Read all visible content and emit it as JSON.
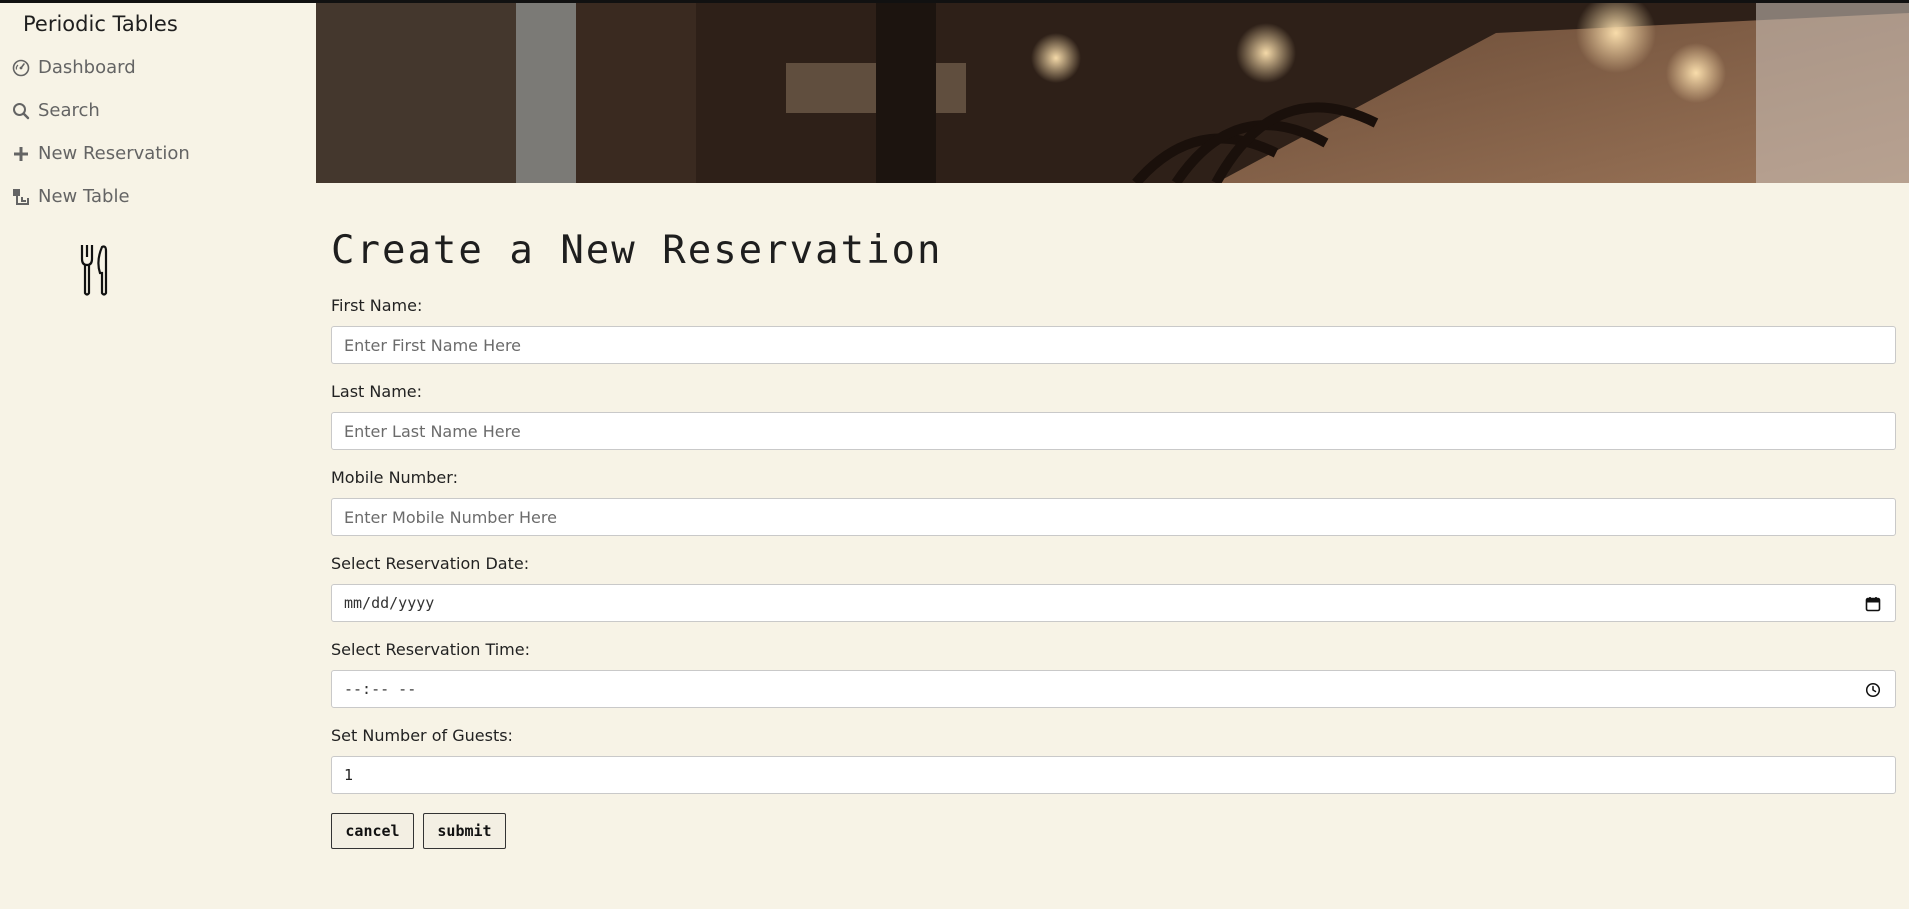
{
  "app": {
    "brand": "Periodic Tables"
  },
  "sidebar": {
    "items": [
      {
        "label": "Dashboard",
        "icon": "dashboard-icon"
      },
      {
        "label": "Search",
        "icon": "search-icon"
      },
      {
        "label": "New Reservation",
        "icon": "plus-icon"
      },
      {
        "label": "New Table",
        "icon": "new-table-icon"
      }
    ],
    "logo_icon": "fork-knife-icon"
  },
  "hero": {
    "image": "restaurant-interior-photo"
  },
  "form": {
    "title": "Create a New Reservation",
    "fields": [
      {
        "label": "First Name:",
        "placeholder": "Enter First Name Here",
        "value": ""
      },
      {
        "label": "Last Name:",
        "placeholder": "Enter Last Name Here",
        "value": ""
      },
      {
        "label": "Mobile Number:",
        "placeholder": "Enter Mobile Number Here",
        "value": ""
      },
      {
        "label": "Select Reservation Date:",
        "placeholder": "mm/dd/yyyy",
        "value": "",
        "icon": "calendar-icon"
      },
      {
        "label": "Select Reservation Time:",
        "placeholder": "--:-- --",
        "value": "",
        "icon": "clock-icon"
      },
      {
        "label": "Set Number of Guests:",
        "placeholder": "",
        "value": "1"
      }
    ],
    "buttons": {
      "cancel": "cancel",
      "submit": "submit"
    }
  },
  "colors": {
    "background": "#f7f3e6",
    "nav_text": "#646464",
    "input_border": "#c9c9c9"
  }
}
